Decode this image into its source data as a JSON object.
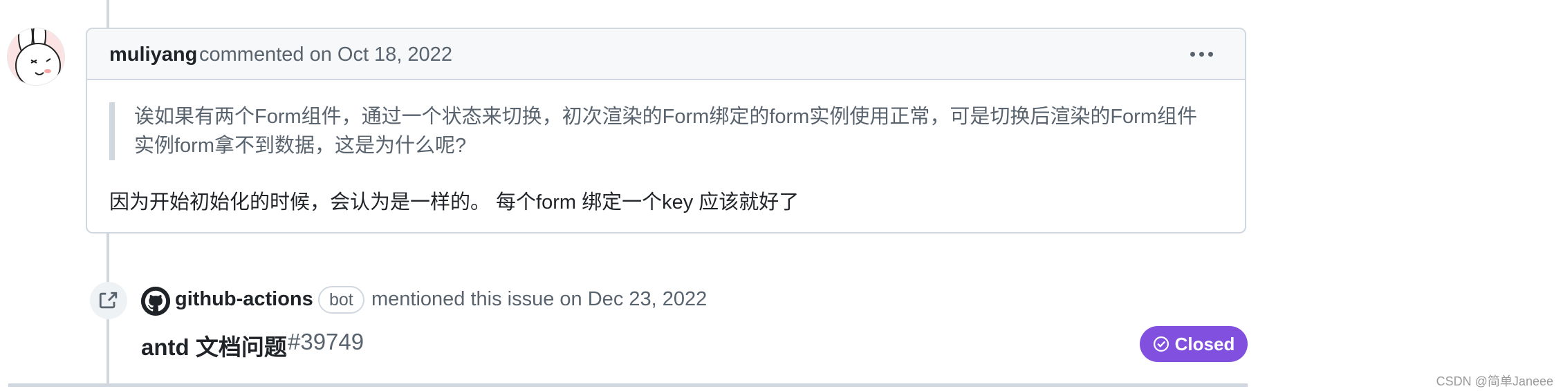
{
  "comment": {
    "author": "muliyang",
    "meta": "commented on Oct 18, 2022",
    "quote": "诶如果有两个Form组件，通过一个状态来切换，初次渲染的Form绑定的form实例使用正常，可是切换后渲染的Form组件实例form拿不到数据，这是为什么呢?",
    "reply": "因为开始初始化的时候，会认为是一样的。 每个form 绑定一个key 应该就好了",
    "avatar_icon": "cartoon-rabbit-avatar",
    "menu_icon": "kebab-horizontal-icon"
  },
  "event": {
    "icon": "cross-reference-icon",
    "actor_icon": "github-logo-icon",
    "actor": "github-actions",
    "bot_label": "bot",
    "text": "mentioned this issue on Dec 23, 2022",
    "issue_title": "antd 文档问题",
    "issue_number": "#39749",
    "status": "Closed",
    "status_icon": "check-circle-icon",
    "status_color": "#8250df"
  },
  "watermark": "CSDN @简单Janeee"
}
